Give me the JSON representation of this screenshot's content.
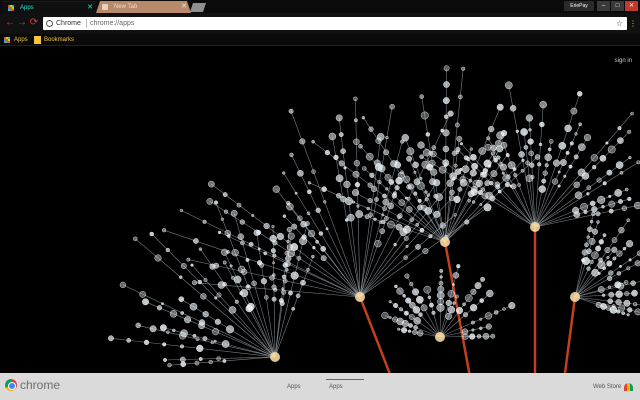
{
  "tabs": [
    {
      "label": "Apps",
      "active": true
    },
    {
      "label": "New Tab",
      "active": false
    }
  ],
  "window": {
    "profile": "EriePay",
    "minimize": "–",
    "maximize": "□",
    "close": "✕"
  },
  "toolbar": {
    "back": "←",
    "forward": "→",
    "reload": "⟳",
    "omnibox_site": "Chrome",
    "omnibox_url": "chrome://apps",
    "star": "☆",
    "menu": "⋮"
  },
  "bookmarks": [
    {
      "label": "Apps",
      "icon": "apps-grid-icon"
    },
    {
      "label": "Bookmarks",
      "icon": "folder-icon"
    }
  ],
  "content": {
    "sign_in": "sign in",
    "background": "dandelion-seeds-with-water-droplets"
  },
  "bottom_bar": {
    "brand": "chrome",
    "pages": [
      "Apps",
      "Apps"
    ],
    "active_page": 2,
    "web_store": "Web Store"
  },
  "colors": {
    "tab_active_text": "#19e6d6",
    "tab_inactive_bg": "#b8896a",
    "nav_buttons": "#e0392b",
    "bookmark_text": "#f3c640",
    "close_button": "#c0392b"
  }
}
